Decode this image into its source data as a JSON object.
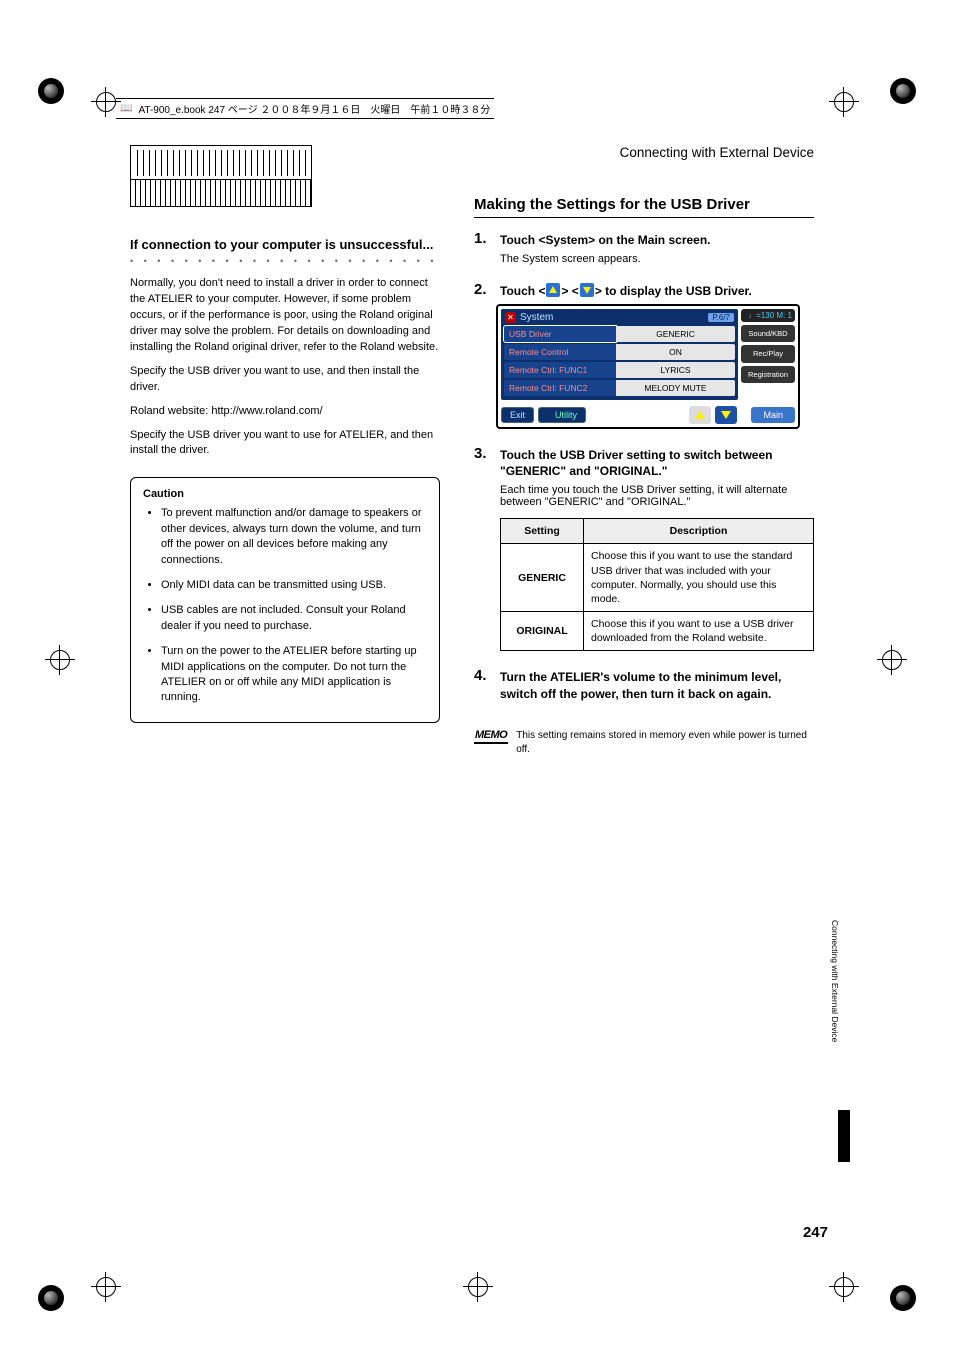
{
  "header_line": "AT-900_e.book  247 ページ  ２００８年９月１６日　火曜日　午前１０時３８分",
  "page_number": "247",
  "chapter_title": "Connecting with External Device",
  "side_text": "Connecting with External Device",
  "left": {
    "heading": "If connection to your computer is unsuccessful...",
    "p1": "Normally, you don't need to install a driver in order to connect the ATELIER to your computer. However, if some problem occurs, or if the performance is poor, using the Roland original driver may solve the problem. For details on downloading and installing the Roland original driver, refer to the Roland website.",
    "p2": "Specify the USB driver you want to use, and then install the driver.",
    "p3": "Roland website: http://www.roland.com/",
    "p4": "Specify the USB driver you want to use for ATELIER, and then install the driver.",
    "caution_title": "Caution",
    "caution": [
      "To prevent malfunction and/or damage to speakers or other devices, always turn down the volume, and turn off the power on all devices before making any connections.",
      "Only MIDI data can be transmitted using USB.",
      "USB cables are not included. Consult your Roland dealer if you need to purchase.",
      "Turn on the power to the ATELIER before starting up MIDI applications on the computer. Do not turn the ATELIER on or off while any MIDI application is running."
    ]
  },
  "right": {
    "section_title": "Making the Settings for the USB Driver",
    "step1_title": "Touch <System> on the Main screen.",
    "step1_body": "The System screen appears.",
    "step2_pre": "Touch <",
    "step2_mid": "> <",
    "step2_post": "> to display the USB Driver.",
    "step3_title": "Touch the USB Driver setting to switch between \"GENERIC\" and \"ORIGINAL.\"",
    "step3_body": "Each time you touch the USB Driver setting, it will alternate between \"GENERIC\" and \"ORIGINAL.\"",
    "step4_title": "Turn the ATELIER's volume to the minimum level, switch off the power, then turn it back on again.",
    "table": {
      "h1": "Setting",
      "h2": "Description",
      "r1n": "GENERIC",
      "r1d": "Choose this if you want to use the standard USB driver that was included with your computer. Normally, you should use this mode.",
      "r2n": "ORIGINAL",
      "r2d": "Choose this if you want to use a USB driver downloaded from the Roland website."
    },
    "memo_label": "MEMO",
    "memo_text": "This setting remains stored in memory even while power is turned off."
  },
  "screenshot": {
    "title": "System",
    "page": "P.6/7",
    "tempo": "♩=130\nM:   1",
    "rows": [
      {
        "lbl": "USB Driver",
        "val": "GENERIC"
      },
      {
        "lbl": "Remote Control",
        "val": "ON"
      },
      {
        "lbl": "Remote Ctrl: FUNC1",
        "val": "LYRICS"
      },
      {
        "lbl": "Remote Ctrl: FUNC2",
        "val": "MELODY MUTE"
      }
    ],
    "side": [
      "Sound/KBD",
      "Rec/Play",
      "Registration"
    ],
    "exit": "Exit",
    "utility": "Utility",
    "main": "Main"
  }
}
